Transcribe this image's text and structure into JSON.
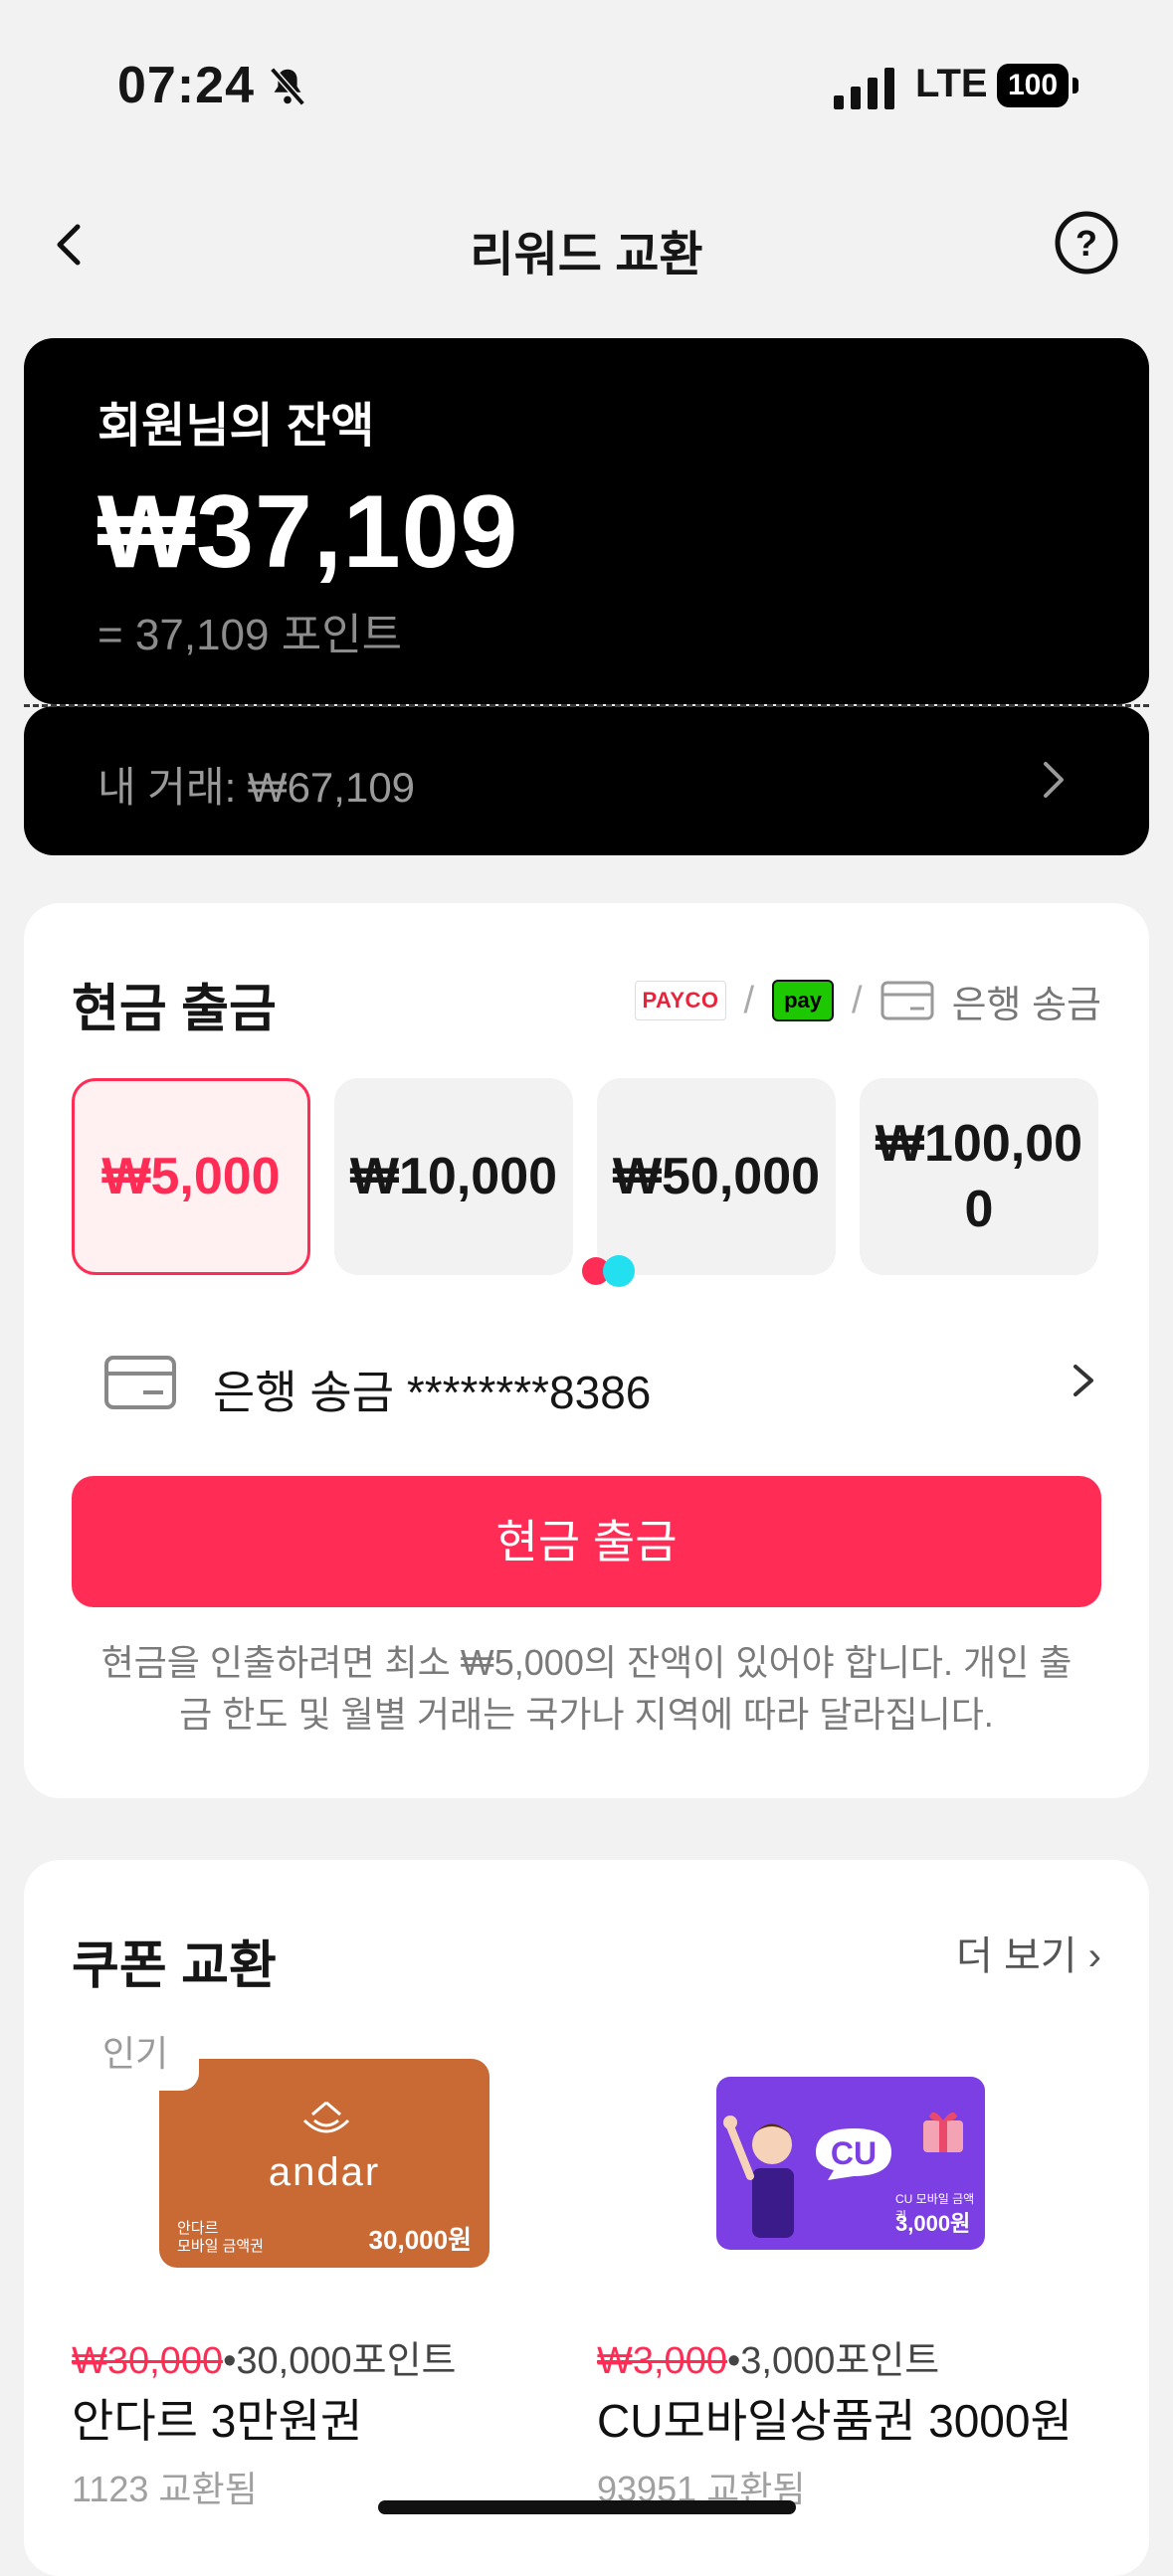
{
  "status_bar": {
    "time": "07:24",
    "network": "LTE",
    "battery": "100"
  },
  "nav": {
    "title": "리워드 교환"
  },
  "balance": {
    "label": "회원님의 잔액",
    "amount": "₩37,109",
    "points": "= 37,109 포인트",
    "transactions": "내 거래: ₩67,109"
  },
  "cash_withdrawal": {
    "title": "현금 출금",
    "methods": {
      "payco": "PAYCO",
      "npay": "pay",
      "bank": "은행 송금"
    },
    "amounts": [
      "₩5,000",
      "₩10,000",
      "₩50,000",
      "₩100,000"
    ],
    "selected_index": 0,
    "bank_account": "은행 송금 ********8386",
    "button_label": "현금 출금",
    "note": "현금을 인출하려면 최소 ₩5,000의 잔액이 있어야 합니다. 개인 출금 한도 및 월별 거래는 국가나 지역에 따라 달라집니다."
  },
  "coupon_exchange": {
    "title": "쿠폰 교환",
    "more_label": "더 보기",
    "items": [
      {
        "badge": "인기",
        "brand": "andar",
        "card_sub": "안다르\n모바일 금액권",
        "card_price": "30,000원",
        "original_price": "₩30,000",
        "points_price": "•30,000포인트",
        "name": "안다르 3만원권",
        "exchanged": "1123 교환됨"
      },
      {
        "brand": "CU",
        "card_sub": "CU 모바일 금액권",
        "card_price": "3,000원",
        "original_price": "₩3,000",
        "points_price": "•3,000포인트",
        "name": "CU모바일상품권 3000원",
        "exchanged": "93951 교환됨"
      }
    ]
  },
  "colors": {
    "accent": "#ff2d55",
    "balance_bg": "#000000",
    "andar": "#c96a35",
    "cu": "#7b3fe4"
  }
}
